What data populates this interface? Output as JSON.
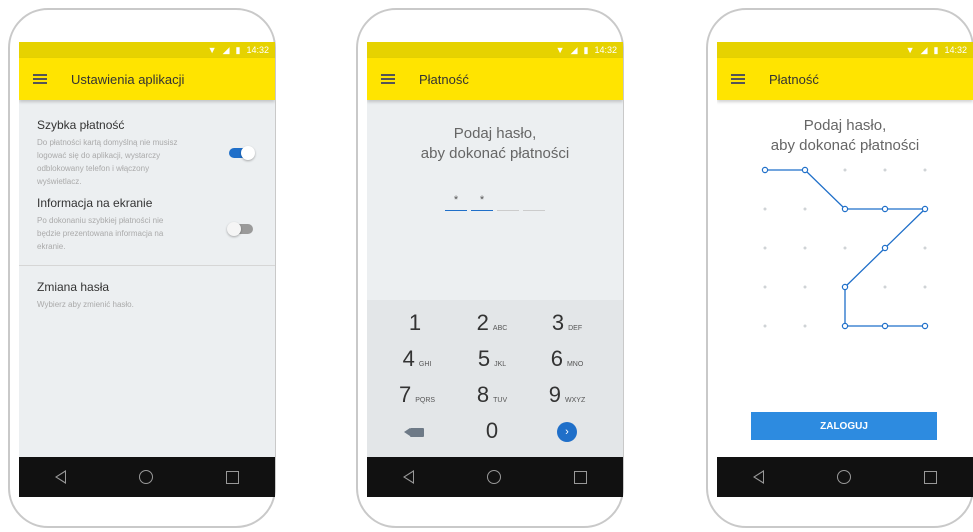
{
  "status": {
    "time": "14:32",
    "wifi_icon": "wifi-icon",
    "signal_icon": "signal-icon",
    "battery_icon": "battery-icon"
  },
  "phone1": {
    "title": "Ustawienia aplikacji",
    "items": [
      {
        "title": "Szybka płatność",
        "desc": "Do płatności kartą domyślną nie musisz logować się do aplikacji, wystarczy odblokowany telefon i włączony wyświetlacz.",
        "toggle": "on"
      },
      {
        "title": "Informacja na ekranie",
        "desc": "Po dokonaniu szybkiej płatności nie będzie prezentowana informacja na ekranie.",
        "toggle": "off"
      },
      {
        "title": "Zmiana hasła",
        "desc": "Wybierz aby zmienić hasło."
      }
    ]
  },
  "phone2": {
    "title": "Płatność",
    "prompt_line1": "Podaj hasło,",
    "prompt_line2": "aby dokonać płatności",
    "pin": [
      "*",
      "*",
      "",
      ""
    ],
    "keys": [
      {
        "num": "1",
        "letters": ""
      },
      {
        "num": "2",
        "letters": "ABC"
      },
      {
        "num": "3",
        "letters": "DEF"
      },
      {
        "num": "4",
        "letters": "GHI"
      },
      {
        "num": "5",
        "letters": "JKL"
      },
      {
        "num": "6",
        "letters": "MNO"
      },
      {
        "num": "7",
        "letters": "PQRS"
      },
      {
        "num": "8",
        "letters": "TUV"
      },
      {
        "num": "9",
        "letters": "WXYZ"
      },
      {
        "num": "0",
        "letters": ""
      }
    ],
    "enter_glyph": "›"
  },
  "phone3": {
    "title": "Płatność",
    "prompt_line1": "Podaj hasło,",
    "prompt_line2": "aby dokonać płatności",
    "pattern_path": [
      [
        0,
        0
      ],
      [
        1,
        0
      ],
      [
        2,
        1
      ],
      [
        3,
        1
      ],
      [
        4,
        1
      ],
      [
        3,
        2
      ],
      [
        2,
        3
      ],
      [
        2,
        4
      ],
      [
        3,
        4
      ],
      [
        4,
        4
      ]
    ],
    "login_label": "ZALOGUJ"
  },
  "colors": {
    "appbar": "#ffe400",
    "statusbar": "#e6d200",
    "accent": "#1f6fc9",
    "button": "#2d8be0"
  }
}
